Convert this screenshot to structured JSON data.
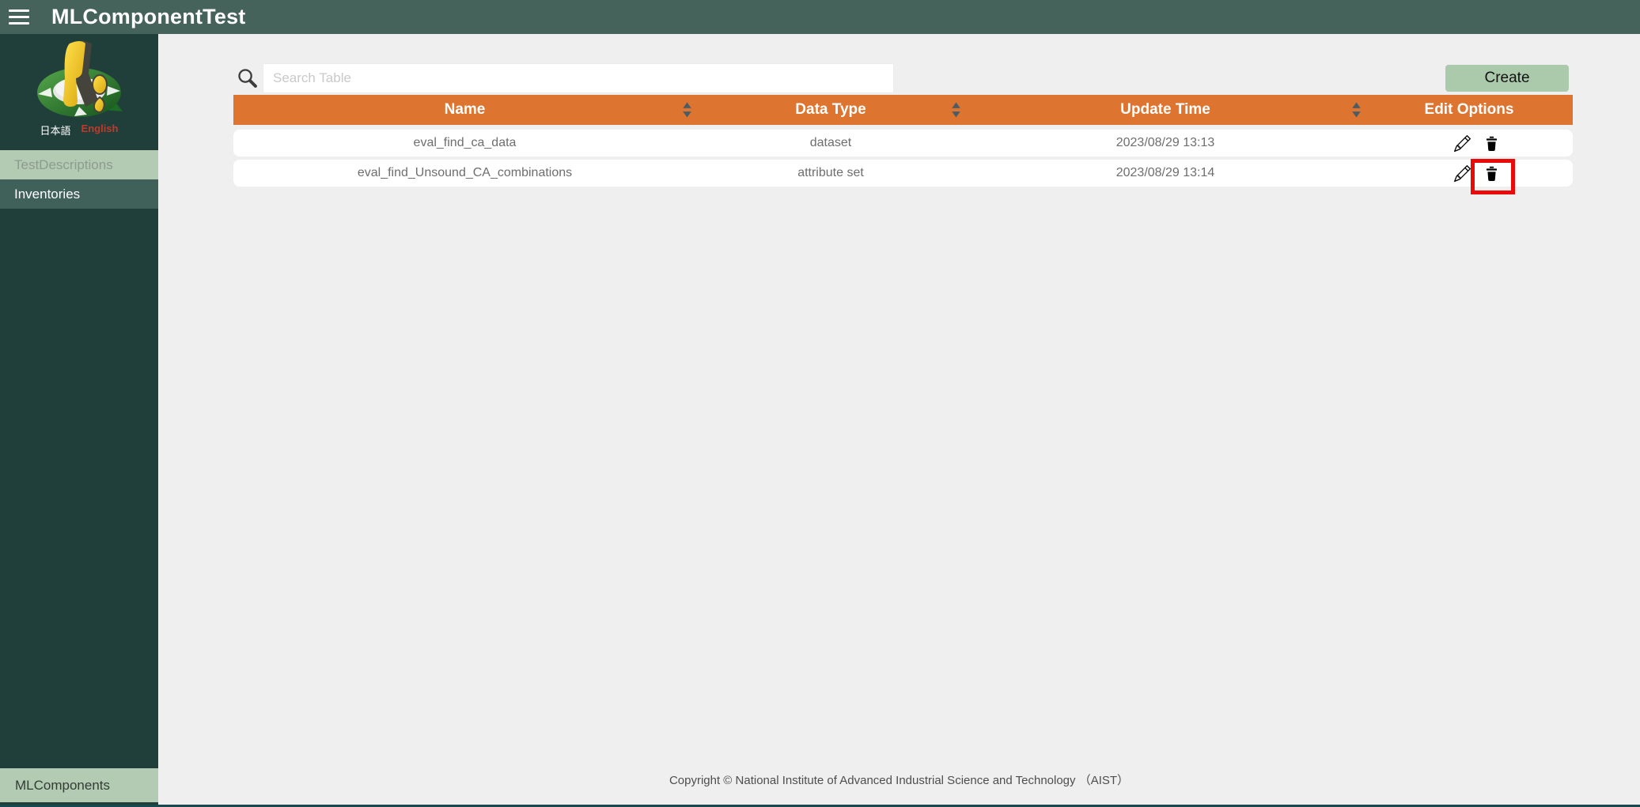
{
  "app": {
    "title": "MLComponentTest"
  },
  "sidebar": {
    "languages": {
      "japanese": "日本語",
      "english": "English"
    },
    "items": [
      {
        "label": "TestDescriptions"
      },
      {
        "label": "Inventories"
      }
    ],
    "bottom_item": "MLComponents"
  },
  "toolbar": {
    "search_placeholder": "Search Table",
    "create_label": "Create"
  },
  "table": {
    "columns": [
      {
        "label": "Name"
      },
      {
        "label": "Data Type"
      },
      {
        "label": "Update Time"
      },
      {
        "label": "Edit Options"
      }
    ],
    "rows": [
      {
        "name": "eval_find_ca_data",
        "data_type": "dataset",
        "update_time": "2023/08/29 13:13"
      },
      {
        "name": "eval_find_Unsound_CA_combinations",
        "data_type": "attribute set",
        "update_time": "2023/08/29 13:14"
      }
    ]
  },
  "footer": {
    "copyright": "Copyright © National Institute of Advanced Industrial Science and Technology （AIST）"
  },
  "colors": {
    "topbar_bg": "#45625b",
    "sidebar_bg": "#203f3a",
    "menu_light_bg": "#b2cbb2",
    "menu_dark_bg": "#40615a",
    "header_orange": "#dd7430",
    "create_green": "#abc9ab",
    "highlight_red": "#eb0a0a",
    "english_link_red": "#c0392b",
    "content_bg": "#efefef"
  }
}
